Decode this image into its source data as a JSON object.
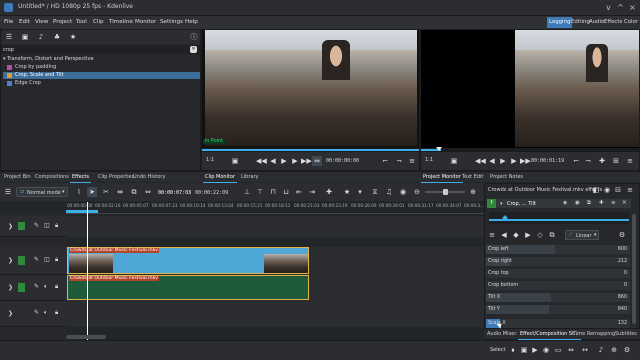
{
  "window": {
    "title": "Untitled* / HD 1080p 25 fps - Kdenlive",
    "controls": [
      "v",
      "^",
      "×"
    ]
  },
  "menu": [
    "File",
    "Edit",
    "View",
    "Project",
    "Tool",
    "Clip",
    "Timeline",
    "Monitor",
    "Settings",
    "Help"
  ],
  "workspaces": [
    "Logging",
    "Editing",
    "Audio",
    "Effects",
    "Color"
  ],
  "effects_panel": {
    "search_value": "crop",
    "tree": {
      "category": "Transform, Distort and Perspective",
      "items": [
        "Crop by padding",
        "Crop, Scale and Tilt",
        "Edge Crop"
      ],
      "selected_index": 1
    }
  },
  "left_tabs": [
    "Project Bin",
    "Compositions",
    "Effects",
    "Clip Properties",
    "Undo History"
  ],
  "clip_monitor": {
    "in_point_label": "In Point",
    "zoom": "1:1",
    "timecode": "00:00:00:00",
    "tabs": [
      "Clip Monitor",
      "Library"
    ]
  },
  "project_monitor": {
    "zoom": "1:1",
    "timecode": "00:00:01:19",
    "tabs": [
      "Project Monitor",
      "Text Edit",
      "Project Notes"
    ]
  },
  "timeline_toolbar": {
    "mode": "Normal mode",
    "position": "00:00:07:03",
    "duration": "00:00:22:09"
  },
  "ruler_labels": [
    "00:00:00:00",
    "00:00:02:16",
    "00:00:05:07",
    "00:00:07:23",
    "00:00:10:14",
    "00:00:13:04",
    "00:00:15:21",
    "00:00:18:12",
    "00:00:21:03",
    "00:00:23:19",
    "00:00:26:09",
    "00:00:29:01",
    "00:00:31:17",
    "00:00:34:07",
    "00:00:3..."
  ],
  "clips": {
    "video_name": "Crowds at Outdoor Music Festival.mkv",
    "audio_name": "Crowds at Outdoor Music Festival.mkv"
  },
  "effect_stack": {
    "title": "Crowds at Outdoor Music Festival.mkv effects",
    "effect_name": "Crop, ... Tilt",
    "interp": "Linear",
    "params": [
      {
        "name": "Crop left",
        "value": "600",
        "fill": 0.48
      },
      {
        "name": "Crop right",
        "value": "212",
        "fill": 0.17
      },
      {
        "name": "Crop top",
        "value": "0",
        "fill": 0.0
      },
      {
        "name": "Crop bottom",
        "value": "0",
        "fill": 0.0
      },
      {
        "name": "Tilt X",
        "value": "860",
        "fill": 0.45
      },
      {
        "name": "Tilt Y",
        "value": "840",
        "fill": 0.44
      },
      {
        "name": "Scale X",
        "value": "132",
        "fill": 0.1
      }
    ],
    "tabs": [
      "Audio Mixer",
      "Effect/Composition St...",
      "Time Remapping",
      "Subtitles"
    ]
  },
  "status": {
    "select_label": "Select"
  },
  "colors": {
    "accent": "#3daee9",
    "workspace_active": "#3d7ab8",
    "clip_label": "#b2452a",
    "video_clip": "#4fa7d8",
    "audio_clip": "#1f5a3a"
  }
}
